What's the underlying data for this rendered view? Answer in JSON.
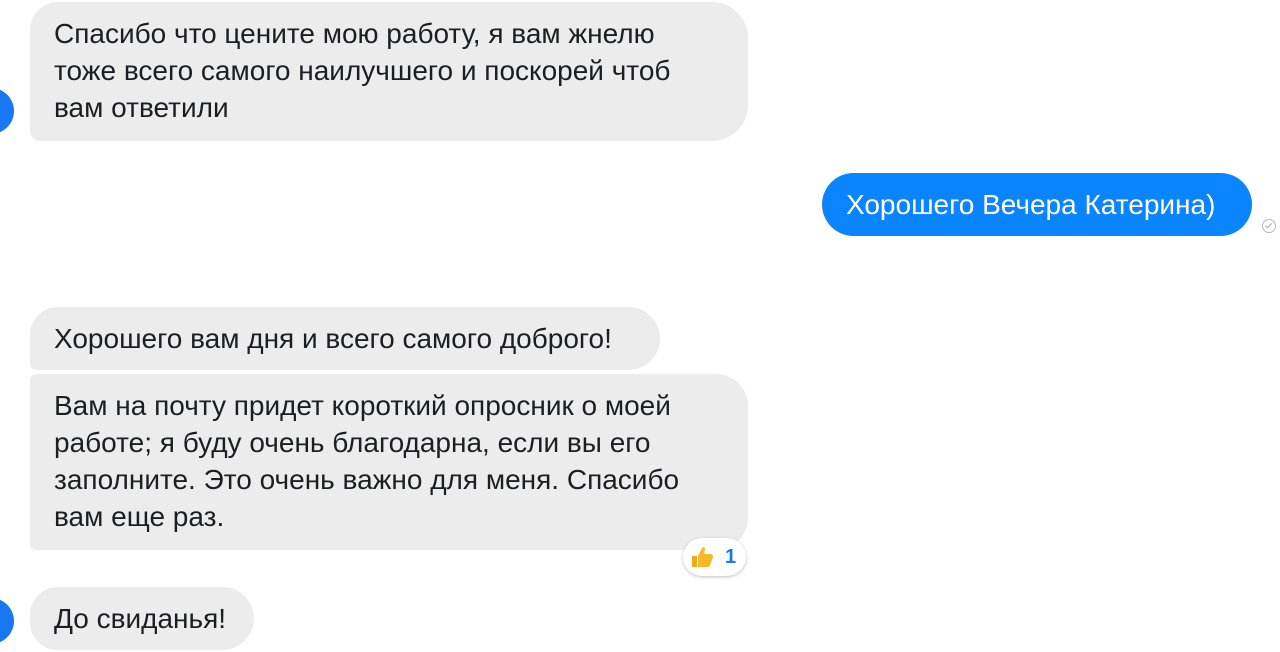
{
  "messages": {
    "m1": "Спасибо что цените мою работу, я вам жнелю тоже всего самого наилучшего и поскорей чтоб вам ответили",
    "m2": "Хорошего Вечера Катерина)",
    "m3": "Хорошего вам дня и всего самого доброго!",
    "m4": "Вам на почту придет короткий опросник о моей работе; я буду очень благодарна, если вы его заполните. Это очень важно для меня. Спасибо вам еще раз.",
    "m5": "До свиданья!"
  },
  "reaction": {
    "icon": "thumbs-up-icon",
    "count": "1"
  },
  "colors": {
    "incoming_bubble": "#ececec",
    "outgoing_bubble": "#0a84ff",
    "avatar": "#1877f2",
    "reaction_count": "#1877f2"
  }
}
